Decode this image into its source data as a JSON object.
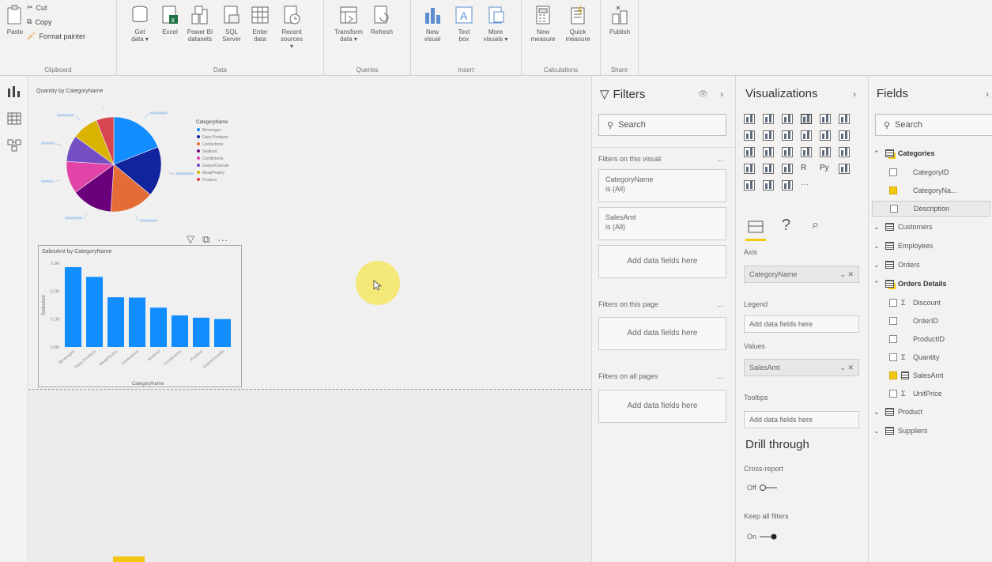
{
  "ribbon": {
    "clipboard": {
      "paste": "Paste",
      "cut": "Cut",
      "copy": "Copy",
      "format_painter": "Format painter",
      "label": "Clipboard"
    },
    "data": {
      "label": "Data",
      "buttons": [
        {
          "l1": "Get",
          "l2": "data ▾"
        },
        {
          "l1": "Excel",
          "l2": ""
        },
        {
          "l1": "Power BI",
          "l2": "datasets"
        },
        {
          "l1": "SQL",
          "l2": "Server"
        },
        {
          "l1": "Enter",
          "l2": "data"
        },
        {
          "l1": "Recent",
          "l2": "sources ▾"
        }
      ]
    },
    "queries": {
      "label": "Queries",
      "buttons": [
        {
          "l1": "Transform",
          "l2": "data ▾"
        },
        {
          "l1": "Refresh",
          "l2": ""
        }
      ]
    },
    "insert": {
      "label": "Insert",
      "buttons": [
        {
          "l1": "New",
          "l2": "visual"
        },
        {
          "l1": "Text",
          "l2": "box"
        },
        {
          "l1": "More",
          "l2": "visuals ▾"
        }
      ]
    },
    "calculations": {
      "label": "Calculations",
      "buttons": [
        {
          "l1": "New",
          "l2": "measure"
        },
        {
          "l1": "Quick",
          "l2": "measure"
        }
      ]
    },
    "share": {
      "label": "Share",
      "buttons": [
        {
          "l1": "Publish",
          "l2": ""
        }
      ]
    }
  },
  "pie_visual": {
    "title": "Quantity by CategoryName",
    "legend_title": "CategoryName",
    "slices": [
      {
        "name": "Beverages",
        "color": "#118dff"
      },
      {
        "name": "Dairy Products",
        "color": "#12239e"
      },
      {
        "name": "Confections",
        "color": "#e66c37"
      },
      {
        "name": "Seafood",
        "color": "#6b007b"
      },
      {
        "name": "Condiments",
        "color": "#e044a7"
      },
      {
        "name": "Grains/Cereals",
        "color": "#744ec2"
      },
      {
        "name": "Meat/Poultry",
        "color": "#d9b300"
      },
      {
        "name": "Produce",
        "color": "#d64550"
      }
    ],
    "values": [
      19,
      17,
      15,
      14,
      11,
      9,
      9,
      6
    ]
  },
  "chart_data": {
    "type": "bar",
    "title": "SalesAmt by CategoryName",
    "xlabel": "CategoryName",
    "ylabel": "SalesAmt",
    "categories": [
      "Beverages",
      "Dairy Products",
      "Meat/Poultry",
      "Confections",
      "Seafood",
      "Condiments",
      "Produce",
      "Grains/Cereals"
    ],
    "values": [
      286,
      251,
      178,
      177,
      141,
      113,
      105,
      100
    ],
    "ylim": [
      0,
      300
    ],
    "yticks": [
      "0.0M",
      "0.1M",
      "0.2M",
      "0.3M"
    ],
    "color": "#118dff"
  },
  "visual_toolbar": {
    "filter_icon": "filter-icon",
    "focus_icon": "focus-mode-icon",
    "more": "···"
  },
  "filters": {
    "title": "Filters",
    "search_placeholder": "Search",
    "on_visual": "Filters on this visual",
    "card1_name": "CategoryName",
    "card1_value": "is (All)",
    "card2_name": "SalesAmt",
    "card2_value": "is (All)",
    "add_here": "Add data fields here",
    "on_page": "Filters on this page",
    "on_all": "Filters on all pages",
    "more": "..."
  },
  "visualizations": {
    "title": "Visualizations",
    "axis_label": "Axis",
    "axis_value": "CategoryName",
    "legend_label": "Legend",
    "legend_value": "Add data fields here",
    "values_label": "Values",
    "values_value": "SalesAmt",
    "tooltips_label": "Tooltips",
    "tooltips_value": "Add data fields here",
    "drill_title": "Drill through",
    "cross_report": "Cross-report",
    "cross_state": "Off",
    "keep_filters": "Keep all filters",
    "keep_state": "On",
    "remove": "✕",
    "r_label": "R",
    "py_label": "Py"
  },
  "fields": {
    "title": "Fields",
    "search_placeholder": "Search",
    "tables": [
      {
        "name": "Categories",
        "expanded": true,
        "items": [
          {
            "name": "CategoryID",
            "checked": false,
            "sigma": false
          },
          {
            "name": "CategoryNa...",
            "checked": true,
            "sigma": false
          },
          {
            "name": "Description",
            "checked": false,
            "sigma": false
          }
        ]
      },
      {
        "name": "Customers",
        "expanded": false,
        "items": []
      },
      {
        "name": "Employees",
        "expanded": false,
        "items": []
      },
      {
        "name": "Orders",
        "expanded": false,
        "items": []
      },
      {
        "name": "Orders Details",
        "expanded": true,
        "items": [
          {
            "name": "Discount",
            "checked": false,
            "sigma": true
          },
          {
            "name": "OrderID",
            "checked": false,
            "sigma": false
          },
          {
            "name": "ProductID",
            "checked": false,
            "sigma": false
          },
          {
            "name": "Quantity",
            "checked": false,
            "sigma": true
          },
          {
            "name": "SalesAmt",
            "checked": true,
            "sigma": false
          },
          {
            "name": "UnitPrice",
            "checked": false,
            "sigma": true
          }
        ]
      },
      {
        "name": "Product",
        "expanded": false,
        "items": []
      },
      {
        "name": "Suppliers",
        "expanded": false,
        "items": []
      }
    ]
  },
  "colors": {
    "accent": "#f2c811",
    "bar": "#118dff",
    "cursor_highlight": "#f5e663"
  }
}
